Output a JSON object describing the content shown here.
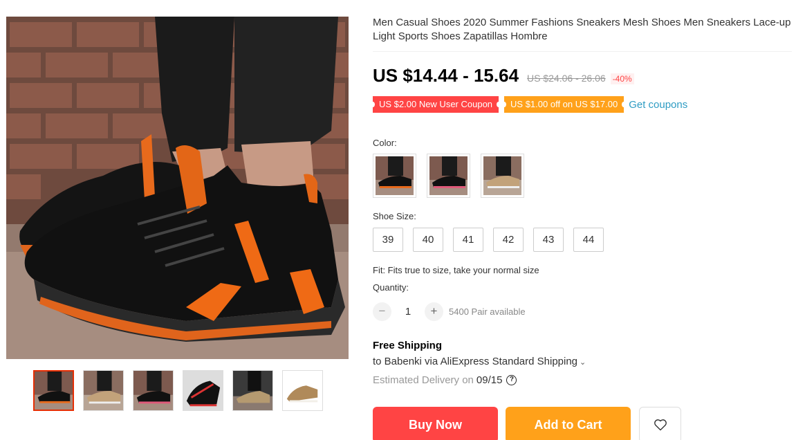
{
  "product": {
    "title": "Men Casual Shoes 2020 Summer Fashions Sneakers Mesh Shoes Men Sneakers Lace-up Light Sports Shoes Zapatillas Hombre",
    "price": "US $14.44 - 15.64",
    "original_price": "US $24.06 - 26.06",
    "discount": "-40%"
  },
  "coupons": {
    "new_user": "US $2.00 New User Coupon",
    "store": "US $1.00 off on US $17.00",
    "get_link": "Get coupons",
    "colors": {
      "red": "#ff4444",
      "orange": "#ffa11a",
      "link": "#2e9cc3"
    }
  },
  "color": {
    "label": "Color:",
    "options": [
      "black-orange",
      "black-grey",
      "khaki"
    ]
  },
  "size": {
    "label": "Shoe Size:",
    "options": [
      "39",
      "40",
      "41",
      "42",
      "43",
      "44"
    ],
    "fit_note": "Fit: Fits true to size, take your normal size"
  },
  "quantity": {
    "label": "Quantity:",
    "minus": "−",
    "value": "1",
    "plus": "+",
    "available": "5400 Pair available"
  },
  "shipping": {
    "title": "Free Shipping",
    "to": "to Babenki via AliExpress Standard Shipping",
    "chevron": "⌄",
    "estimated_label": "Estimated Delivery on",
    "estimated_date": "09/15",
    "help": "?"
  },
  "actions": {
    "buy_now": "Buy Now",
    "add_to_cart": "Add to Cart",
    "wishlist_icon": "heart-icon"
  },
  "gallery": {
    "thumbnails": [
      "black-orange-side",
      "khaki-side",
      "black-pink-side",
      "black-red-angle",
      "khaki-grey-side",
      "khaki-top"
    ],
    "active_index": 0
  }
}
